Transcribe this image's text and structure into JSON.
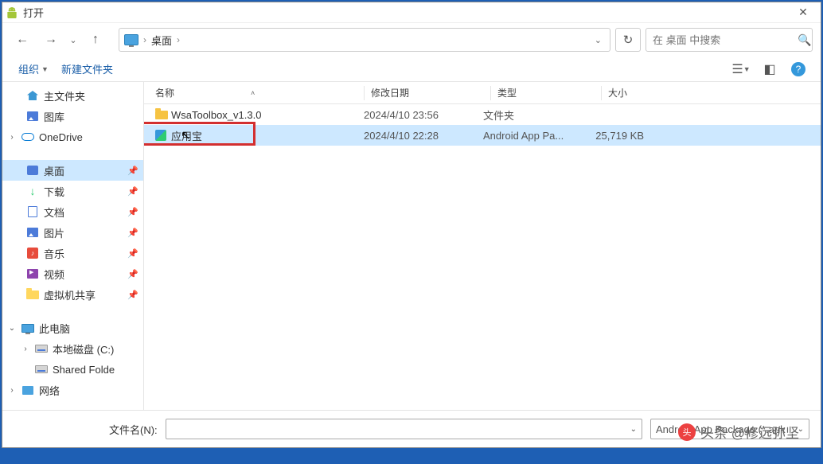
{
  "title": "打开",
  "breadcrumb": {
    "location": "桌面"
  },
  "search": {
    "placeholder": "在 桌面 中搜索"
  },
  "toolbar": {
    "organize": "组织",
    "newfolder": "新建文件夹"
  },
  "columns": {
    "name": "名称",
    "date": "修改日期",
    "type": "类型",
    "size": "大小"
  },
  "sidebar": {
    "home": "主文件夹",
    "gallery": "图库",
    "onedrive": "OneDrive",
    "desktop": "桌面",
    "downloads": "下载",
    "documents": "文档",
    "pictures": "图片",
    "music": "音乐",
    "videos": "视频",
    "vmshare": "虚拟机共享",
    "thispc": "此电脑",
    "localdisk": "本地磁盘 (C:)",
    "sharedfolder": "Shared Folde",
    "network": "网络"
  },
  "files": [
    {
      "name": "WsaToolbox_v1.3.0",
      "date": "2024/4/10 23:56",
      "type": "文件夹",
      "size": ""
    },
    {
      "name": "应用宝",
      "date": "2024/4/10 22:28",
      "type": "Android App Pa...",
      "size": "25,719 KB"
    }
  ],
  "bottom": {
    "filename_label": "文件名(N):",
    "filetype": "Android App Package (*.apk"
  },
  "watermark": "头条 @修远弥坚"
}
